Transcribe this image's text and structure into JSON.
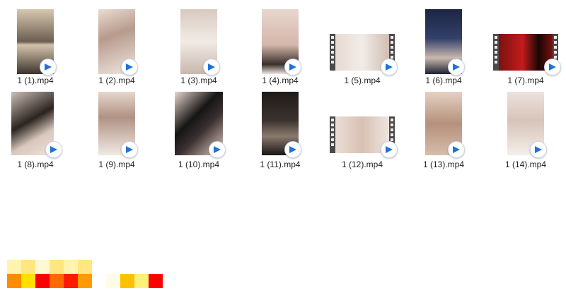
{
  "files": [
    {
      "name": "1 (1).mp4"
    },
    {
      "name": "1 (2).mp4"
    },
    {
      "name": "1 (3).mp4"
    },
    {
      "name": "1 (4).mp4"
    },
    {
      "name": "1 (5).mp4"
    },
    {
      "name": "1 (6).mp4"
    },
    {
      "name": "1 (7).mp4"
    },
    {
      "name": "1 (8).mp4"
    },
    {
      "name": "1 (9).mp4"
    },
    {
      "name": "1 (10).mp4"
    },
    {
      "name": "1 (11).mp4"
    },
    {
      "name": "1 (12).mp4"
    },
    {
      "name": "1 (13).mp4"
    },
    {
      "name": "1 (14).mp4"
    }
  ],
  "icons": {
    "overlay": "video-player-icon"
  },
  "colors": {
    "badge_blue": "#1e73d8",
    "label_text": "#222222"
  }
}
